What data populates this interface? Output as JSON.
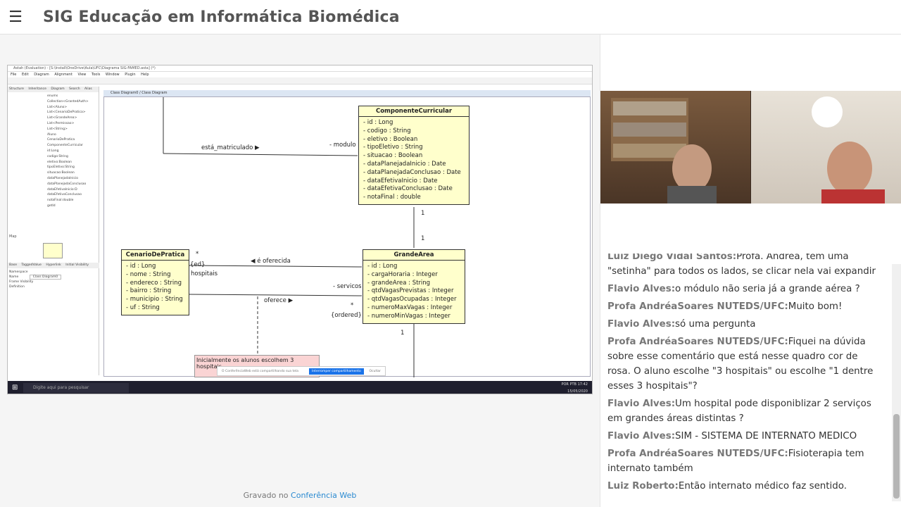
{
  "app": {
    "title": "SIG Educação em Informática Biomédica"
  },
  "footer": {
    "prefix": "Gravado no",
    "link": "Conferência Web"
  },
  "chat": [
    {
      "who": "Luiz Diego Vidal Santos:",
      "text": "Profa. Andréa, tem uma \"setinha\" para todos os lados, se clicar nela vai expandir"
    },
    {
      "who": "Flavio Alves:",
      "text": "o módulo não seria já a grande aérea ?"
    },
    {
      "who": "Profa AndréaSoares NUTEDS/UFC:",
      "text": "Muito bom!"
    },
    {
      "who": "Flavio Alves:",
      "text": "só uma pergunta"
    },
    {
      "who": "Profa AndréaSoares NUTEDS/UFC:",
      "text": "Fiquei na dúvida sobre esse comentário que está nesse quadro cor de rosa. O aluno escolhe \"3 hospitais\" ou escolhe \"1 dentre esses 3 hospitais\"?"
    },
    {
      "who": "Flavio Alves:",
      "text": "Um hospital pode disponiblizar 2 serviços em grandes áreas distintas ?"
    },
    {
      "who": "Flavio Alves:",
      "text": "SIM - SISTEMA DE INTERNATO MEDICO"
    },
    {
      "who": "Profa AndréaSoares NUTEDS/UFC:",
      "text": "Fisioterapia tem internato também"
    },
    {
      "who": "Luiz Roberto:",
      "text": "Então internato médico faz sentido."
    }
  ],
  "screen": {
    "window_title": "Astah (Evaluation) - [S:\\Install\\OneDrive\\Aula\\UFC\\Diagrama SIG-FAMED.asta] (*)",
    "menu": [
      "File",
      "Edit",
      "Diagram",
      "Alignment",
      "View",
      "Tools",
      "Window",
      "Plugin",
      "Help"
    ],
    "left_tabs": [
      "Structure",
      "Inheritance",
      "Diagram",
      "Search",
      "Alias"
    ],
    "tree": [
      "enums",
      "Collection<GrantedAuth>",
      "List<Aluno>",
      "List<CenarioDePratica>",
      "List<GrandeArea>",
      "List<Permissao>",
      "List<String>",
      "Aluno",
      "CenarioDePratica",
      "ComponenteCurricular",
      "id:Long",
      "codigo:String",
      "eletivo:Boolean",
      "tipoEletivo:String",
      "situacao:Boolean",
      "dataPlanejadaInicio",
      "dataPlanejadaConclusao",
      "dataEfetivaInicio:D",
      "dataEfetivaConclusao",
      "notaFinal:double",
      "getId"
    ],
    "canvas_tab": "Class Diagram0 / Class Diagram",
    "props_tabs": [
      "Base",
      "TaggedValue",
      "Hyperlink",
      "Initial Visibility"
    ],
    "props_fields": [
      "Namespace",
      "Name",
      "Class Diagram0",
      "Frame Visibility",
      "Definition"
    ],
    "classes": {
      "componente": {
        "name": "ComponenteCurricular",
        "attrs": [
          "- id : Long",
          "- codigo : String",
          "- eletivo : Boolean",
          "- tipoEletivo : String",
          "- situacao : Boolean",
          "- dataPlanejadaInicio : Date",
          "- dataPlanejadaConclusao : Date",
          "- dataEfetivaInicio : Date",
          "- dataEfetivaConclusao : Date",
          "- notaFinal : double"
        ]
      },
      "cenario": {
        "name": "CenarioDePratica",
        "attrs": [
          "- id : Long",
          "- nome : String",
          "- endereco : String",
          "- bairro : String",
          "- municipio : String",
          "- uf : String"
        ]
      },
      "grande": {
        "name": "GrandeArea",
        "attrs": [
          "- id : Long",
          "- cargaHoraria : Integer",
          "- grandeArea : String",
          "- qtdVagasPrevistas : Integer",
          "- qtdVagasOcupadas : Integer",
          "- numeroMaxVagas : Integer",
          "- numeroMinVagas : Integer"
        ]
      }
    },
    "labels": {
      "matriculado": "está_matriculado",
      "modulo": "- modulo",
      "oferecida": "é oferecida",
      "hospitais": "hospitais",
      "servicos": "- servicos",
      "oferece": "oferece",
      "ordered": "{ordered}",
      "ed": "{ed}",
      "one": "1",
      "star": "*"
    },
    "note": "Inicialmente os alunos escolhem 3 hospitais",
    "share_bar": {
      "text": "O ConferênciaWeb está compartilhando sua tela",
      "stop": "Interromper compartilhamento",
      "hide": "Ocultar"
    },
    "taskbar": {
      "search": "Digite aqui para pesquisar",
      "lang": "POR PTB",
      "time": "17:42",
      "date": "15/05/2020"
    }
  }
}
